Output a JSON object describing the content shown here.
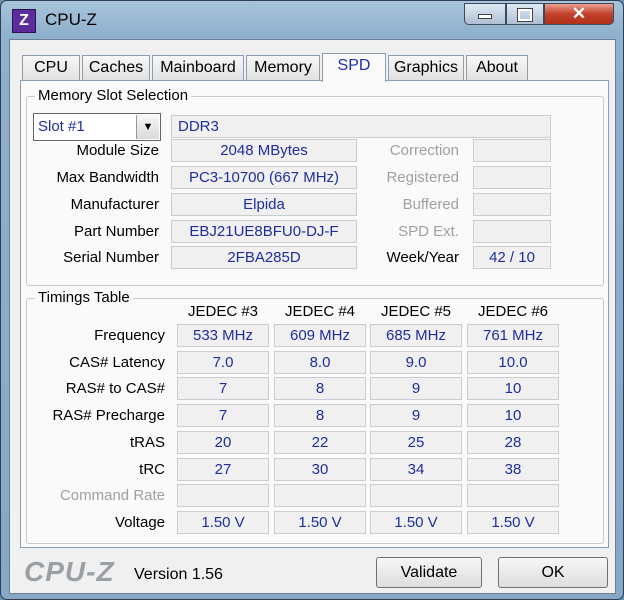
{
  "window": {
    "title": "CPU-Z",
    "icon_letter": "Z",
    "close_glyph": "✕"
  },
  "tabs": [
    "CPU",
    "Caches",
    "Mainboard",
    "Memory",
    "SPD",
    "Graphics",
    "About"
  ],
  "active_tab": "SPD",
  "slot_selection": {
    "group_title": "Memory Slot Selection",
    "slot_value": "Slot #1",
    "memory_type": "DDR3",
    "labels": {
      "module_size": "Module Size",
      "max_bandwidth": "Max Bandwidth",
      "manufacturer": "Manufacturer",
      "part_number": "Part Number",
      "serial_number": "Serial Number",
      "correction": "Correction",
      "registered": "Registered",
      "buffered": "Buffered",
      "spd_ext": "SPD Ext.",
      "week_year": "Week/Year"
    },
    "values": {
      "module_size": "2048 MBytes",
      "max_bandwidth": "PC3-10700 (667 MHz)",
      "manufacturer": "Elpida",
      "part_number": "EBJ21UE8BFU0-DJ-F",
      "serial_number": "2FBA285D",
      "correction": "",
      "registered": "",
      "buffered": "",
      "spd_ext": "",
      "week_year": "42 / 10"
    }
  },
  "timings": {
    "group_title": "Timings Table",
    "columns": [
      "JEDEC #3",
      "JEDEC #4",
      "JEDEC #5",
      "JEDEC #6"
    ],
    "rows": [
      {
        "label": "Frequency",
        "values": [
          "533 MHz",
          "609 MHz",
          "685 MHz",
          "761 MHz"
        ]
      },
      {
        "label": "CAS# Latency",
        "values": [
          "7.0",
          "8.0",
          "9.0",
          "10.0"
        ]
      },
      {
        "label": "RAS# to CAS#",
        "values": [
          "7",
          "8",
          "9",
          "10"
        ]
      },
      {
        "label": "RAS# Precharge",
        "values": [
          "7",
          "8",
          "9",
          "10"
        ]
      },
      {
        "label": "tRAS",
        "values": [
          "20",
          "22",
          "25",
          "28"
        ]
      },
      {
        "label": "tRC",
        "values": [
          "27",
          "30",
          "34",
          "38"
        ]
      },
      {
        "label": "Command Rate",
        "values": [
          "",
          "",
          "",
          ""
        ],
        "disabled": true
      },
      {
        "label": "Voltage",
        "values": [
          "1.50 V",
          "1.50 V",
          "1.50 V",
          "1.50 V"
        ]
      }
    ]
  },
  "footer": {
    "logo": "CPU-Z",
    "version": "Version 1.56",
    "validate_label": "Validate",
    "ok_label": "OK"
  }
}
